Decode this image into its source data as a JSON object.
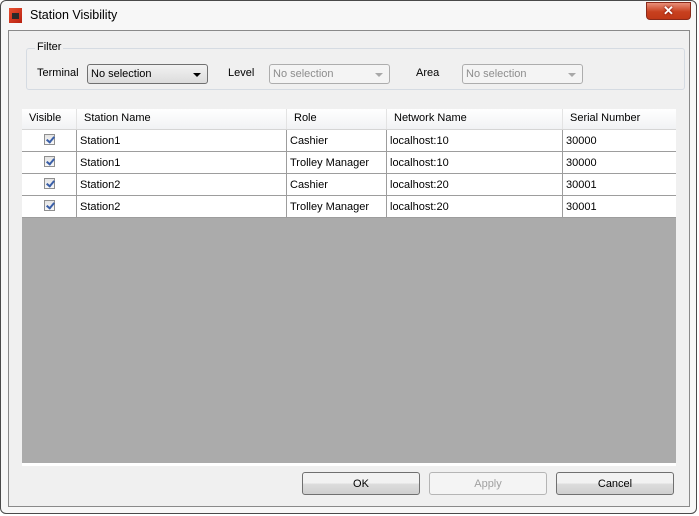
{
  "window": {
    "title": "Station Visibility",
    "close_glyph": "✕"
  },
  "filter": {
    "legend": "Filter",
    "terminal": {
      "label": "Terminal",
      "value": "No selection",
      "enabled": true
    },
    "level": {
      "label": "Level",
      "value": "No selection",
      "enabled": false
    },
    "area": {
      "label": "Area",
      "value": "No selection",
      "enabled": false
    }
  },
  "table": {
    "columns": [
      "Visible",
      "Station Name",
      "Role",
      "Network Name",
      "Serial Number"
    ],
    "rows": [
      {
        "visible": true,
        "station_name": "Station1",
        "role": "Cashier",
        "network_name": "localhost:10",
        "serial_number": "30000"
      },
      {
        "visible": true,
        "station_name": "Station1",
        "role": "Trolley Manager",
        "network_name": "localhost:10",
        "serial_number": "30000"
      },
      {
        "visible": true,
        "station_name": "Station2",
        "role": "Cashier",
        "network_name": "localhost:20",
        "serial_number": "30001"
      },
      {
        "visible": true,
        "station_name": "Station2",
        "role": "Trolley Manager",
        "network_name": "localhost:20",
        "serial_number": "30001"
      }
    ]
  },
  "buttons": {
    "ok": "OK",
    "apply": "Apply",
    "cancel": "Cancel"
  }
}
